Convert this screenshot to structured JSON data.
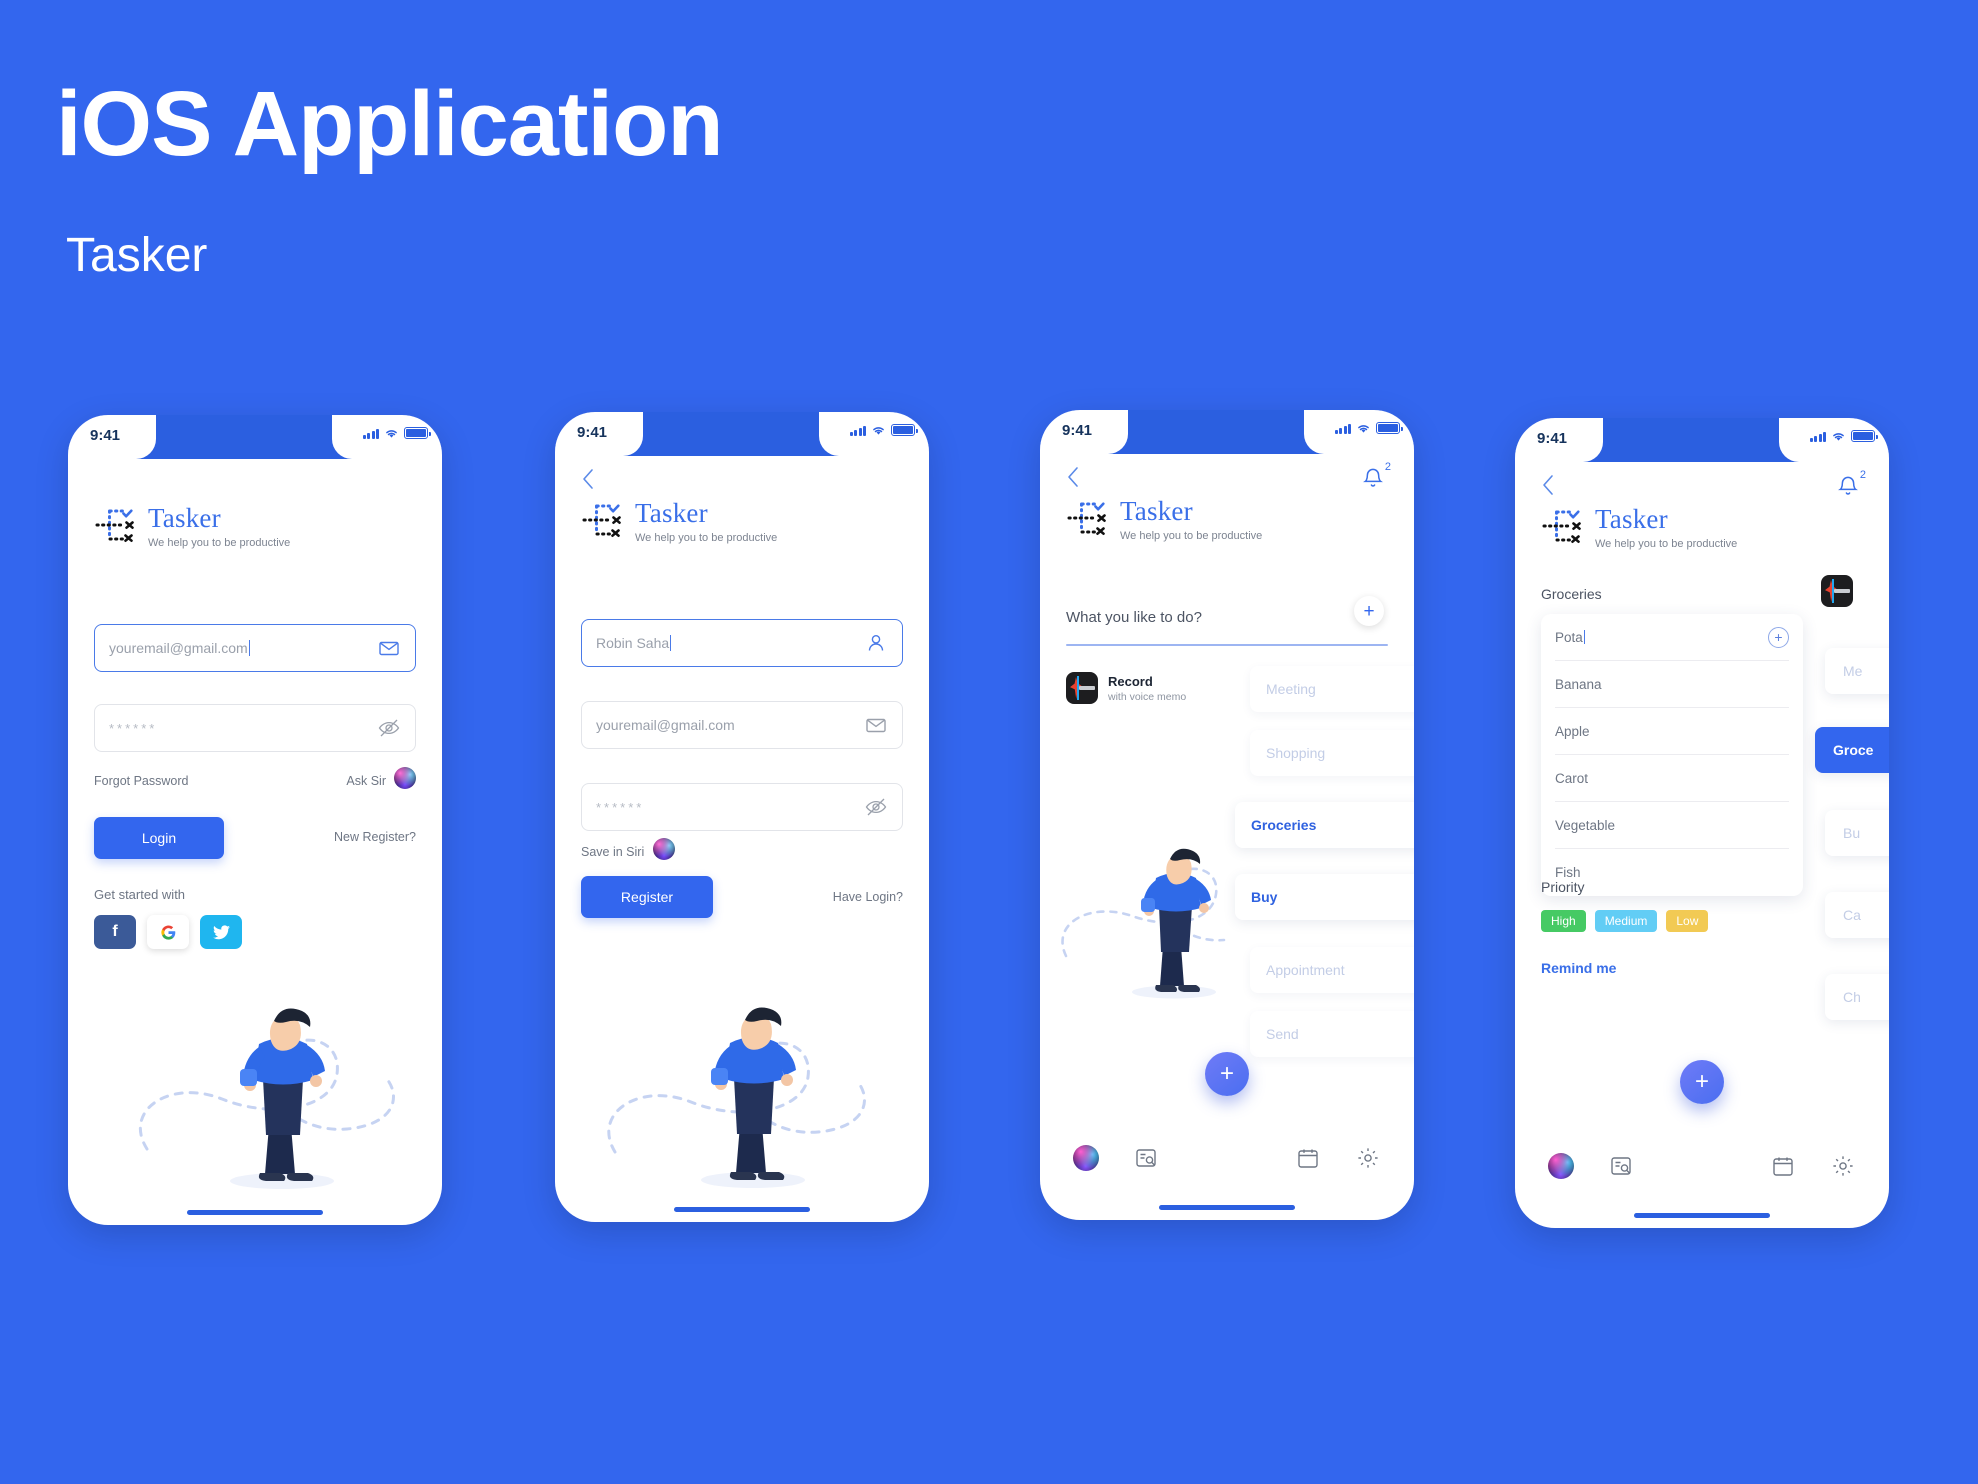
{
  "header": {
    "title": "iOS Application",
    "subtitle": "Tasker"
  },
  "brand": {
    "name": "Tasker",
    "tagline": "We help you to be productive"
  },
  "colors": {
    "background": "#3366ee",
    "accent": "#3a6fe8",
    "statusbar": "#2b5fe0",
    "priority_high": "#46ca64",
    "priority_medium": "#62cdf5",
    "priority_low": "#f2ca54"
  },
  "status_bar": {
    "time": "9:41"
  },
  "screens": {
    "login": {
      "email": {
        "placeholder": "youremail@gmail.com",
        "value": "youremail@gmail.com",
        "icon": "envelope-icon"
      },
      "password": {
        "value": "******",
        "icon": "eye-off-icon"
      },
      "forgot_password": "Forgot Password",
      "ask_siri": "Ask Sir",
      "login_button": "Login",
      "new_register": "New Register?",
      "get_started_with": "Get started with",
      "social": [
        {
          "name": "facebook",
          "glyph": "f"
        },
        {
          "name": "google",
          "glyph": "G"
        },
        {
          "name": "twitter",
          "glyph": "t"
        }
      ]
    },
    "register": {
      "name": {
        "value": "Robin Saha",
        "icon": "person-icon"
      },
      "email": {
        "placeholder": "youremail@gmail.com",
        "value": "youremail@gmail.com",
        "icon": "envelope-icon"
      },
      "password": {
        "value": "******",
        "icon": "eye-off-icon"
      },
      "save_in_siri": "Save in Siri",
      "register_button": "Register",
      "have_login": "Have Login?"
    },
    "tasks": {
      "prompt": "What you like to do?",
      "add_label": "+",
      "notification_count": "2",
      "record": {
        "title": "Record",
        "subtitle": "with voice memo"
      },
      "items": [
        {
          "label": "Meeting",
          "state": "dim",
          "checked": true
        },
        {
          "label": "Shopping",
          "state": "dim",
          "checked": true
        },
        {
          "label": "Groceries",
          "state": "on",
          "checked": true
        },
        {
          "label": "Buy",
          "state": "on",
          "checked": true
        },
        {
          "label": "Appointment",
          "state": "dim",
          "checked": true
        },
        {
          "label": "Send",
          "state": "dim",
          "checked": true
        }
      ],
      "fab": "+"
    },
    "detail": {
      "section_title": "Groceries",
      "notification_count": "2",
      "items": [
        {
          "label": "Pota",
          "editing": true
        },
        {
          "label": "Banana",
          "editing": false
        },
        {
          "label": "Apple",
          "editing": false
        },
        {
          "label": "Carot",
          "editing": false
        },
        {
          "label": "Vegetable",
          "editing": false
        },
        {
          "label": "Fish",
          "editing": false
        }
      ],
      "priority_title": "Priority",
      "priorities": [
        {
          "label": "High",
          "level": "high"
        },
        {
          "label": "Medium",
          "level": "medium"
        },
        {
          "label": "Low",
          "level": "low"
        }
      ],
      "remind_me": "Remind me",
      "fab": "+",
      "ghost_cards": [
        {
          "label": "Me",
          "selected": false
        },
        {
          "label": "Groce",
          "selected": true
        },
        {
          "label": "Bu",
          "selected": false
        },
        {
          "label": "Ca",
          "selected": false
        },
        {
          "label": "Ch",
          "selected": false
        }
      ]
    }
  }
}
